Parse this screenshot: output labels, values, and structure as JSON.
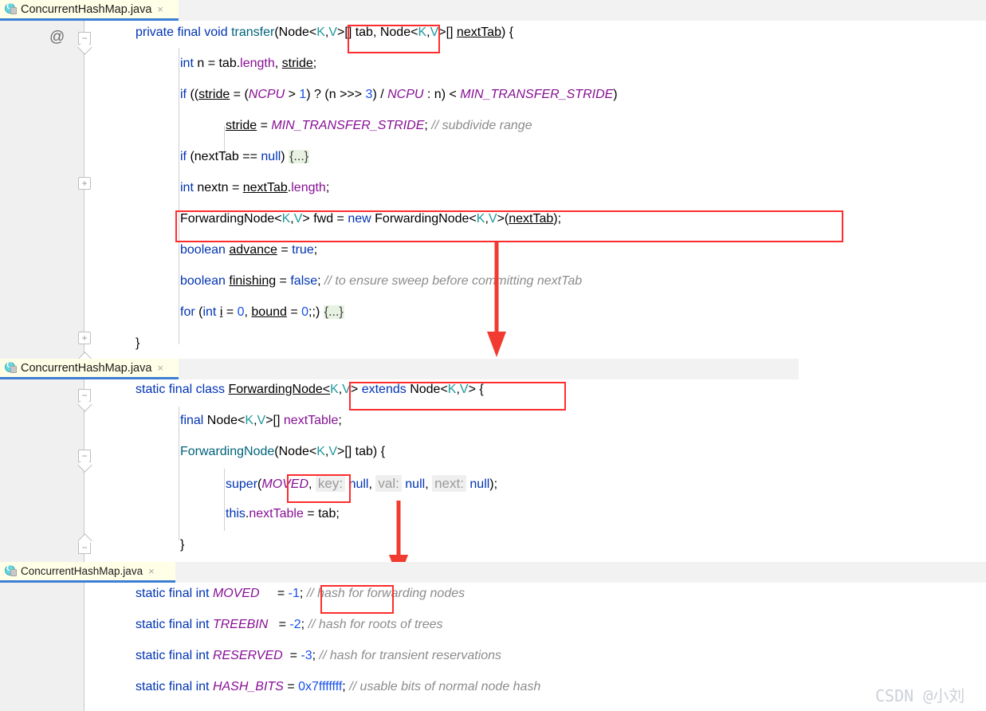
{
  "window": {
    "app": "IntelliJ IDEA editor",
    "accent_color": "#3c7fd4",
    "tab_bg": "#fffee6",
    "gutter_bg": "#f0f0f0",
    "highlight_color": "#ff2d2d",
    "fold_bg": "#e8f2e3"
  },
  "panels": [
    {
      "tab": {
        "label": "ConcurrentHashMap.java",
        "close": "×",
        "icon": "java-class-icon",
        "letter": "C"
      },
      "gutter": {
        "annotation": "@"
      },
      "lines": [
        "private final void transfer(Node<K,V>[] tab, Node<K,V>[] nextTab) {",
        "    int n = tab.length, stride;",
        "    if ((stride = (NCPU > 1) ? (n >>> 3) / NCPU : n) < MIN_TRANSFER_STRIDE)",
        "        stride = MIN_TRANSFER_STRIDE; // subdivide range",
        "    if (nextTab == null) {...}",
        "    int nextn = nextTab.length;",
        "    ForwardingNode<K,V> fwd = new ForwardingNode<K,V>(nextTab);",
        "    boolean advance = true;",
        "    boolean finishing = false; // to ensure sweep before committing nextTab",
        "    for (int i = 0, bound = 0;;) {...}",
        "}"
      ],
      "highlights": [
        "transfer",
        "ForwardingNode<K,V> fwd = new ForwardingNode<K,V>(nextTab);"
      ]
    },
    {
      "tab": {
        "label": "ConcurrentHashMap.java",
        "close": "×",
        "icon": "java-class-icon",
        "letter": "C"
      },
      "lines": [
        "static final class ForwardingNode<K,V> extends Node<K,V> {",
        "    final Node<K,V>[] nextTable;",
        "    ForwardingNode(Node<K,V>[] tab) {",
        "        super(MOVED, key: null, val: null, next: null);",
        "        this.nextTable = tab;",
        "    }"
      ],
      "param_hints": [
        "key:",
        "val:",
        "next:"
      ],
      "highlights": [
        "ForwardingNode<K,V>",
        "MOVED"
      ]
    },
    {
      "tab": {
        "label": "ConcurrentHashMap.java",
        "close": "×",
        "icon": "java-class-icon",
        "letter": "C"
      },
      "lines": [
        "static final int MOVED     = -1; // hash for forwarding nodes",
        "static final int TREEBIN   = -2; // hash for roots of trees",
        "static final int RESERVED  = -3; // hash for transient reservations",
        "static final int HASH_BITS = 0x7fffffff; // usable bits of normal node hash"
      ],
      "constants": [
        {
          "name": "MOVED",
          "value": "-1",
          "comment": "// hash for forwarding nodes"
        },
        {
          "name": "TREEBIN",
          "value": "-2",
          "comment": "// hash for roots of trees"
        },
        {
          "name": "RESERVED",
          "value": "-3",
          "comment": "// hash for transient reservations"
        },
        {
          "name": "HASH_BITS",
          "value": "0x7fffffff",
          "comment": "// usable bits of normal node hash"
        }
      ],
      "highlights": [
        "MOVED"
      ]
    }
  ],
  "tokens": {
    "p1": {
      "l1": {
        "a": "private final void ",
        "b": "transfer",
        "c": "(Node<",
        "k": "K",
        "comma": ",",
        "v": "V",
        "d": ">[] tab, Node<",
        "e": ">[] ",
        "f": "nextTab",
        "g": ") {"
      },
      "l2": {
        "kw": "int",
        "a": " n = tab.",
        "len": "length",
        "b": ", ",
        "stride": "stride",
        "c": ";"
      },
      "l3": {
        "kw": "if",
        "a": " ((",
        "stride": "stride",
        "b": " = (",
        "ncpu": "NCPU",
        "c": " > ",
        "one": "1",
        "d": ") ? (n >>> ",
        "three": "3",
        "e": ") / ",
        "ncpu2": "NCPU",
        "f": " : n) < ",
        "mts": "MIN_TRANSFER_STRIDE",
        "g": ")"
      },
      "l4": {
        "stride": "stride",
        "a": " = ",
        "mts": "MIN_TRANSFER_STRIDE",
        "b": ";",
        "cmt": "// subdivide range"
      },
      "l5": {
        "kw": "if",
        "a": " (nextTab == ",
        "nul": "null",
        "b": ") ",
        "fold": "{...}"
      },
      "l6": {
        "kw": "int",
        "a": " nextn = ",
        "nt": "nextTab",
        "dot": ".",
        "len": "length",
        "b": ";"
      },
      "l7": {
        "a": "ForwardingNode<",
        "k": "K",
        "comma": ",",
        "v": "V",
        "b": "> fwd = ",
        "nw": "new",
        "c": " ForwardingNode<",
        "d": ">(",
        "nt": "nextTab",
        "e": ");"
      },
      "l8": {
        "kw": "boolean",
        "a": " ",
        "adv": "advance",
        "b": " = ",
        "tru": "true",
        "c": ";"
      },
      "l9": {
        "kw": "boolean",
        "a": " ",
        "fin": "finishing",
        "b": " = ",
        "fls": "false",
        "c": ";",
        "cmt": "// to ensure sweep before committing nextTab"
      },
      "l10": {
        "kw": "for",
        "a": " (",
        "kw2": "int",
        "b": " ",
        "i": "i",
        "c": " = ",
        "z1": "0",
        "d": ", ",
        "bound": "bound",
        "e": " = ",
        "z2": "0",
        "f": ";;)",
        "fold": "{...}"
      },
      "l11": {
        "a": "}"
      }
    },
    "p2": {
      "l1": {
        "kw": "static final class",
        "a": " ",
        "cls": "ForwardingNode<",
        "k": "K",
        "comma": ",",
        "v": "V",
        "b": ">",
        "ext": " extends",
        "c": " Node<",
        "d": "> {"
      },
      "l2": {
        "kw": "final",
        "a": " Node<",
        "k": "K",
        "comma": ",",
        "v": "V",
        "b": ">[] ",
        "fld": "nextTable",
        "c": ";"
      },
      "l3": {
        "ctor": "ForwardingNode",
        "a": "(Node<",
        "k": "K",
        "comma": ",",
        "v": "V",
        "b": ">[] tab) {"
      },
      "l4": {
        "sup": "super",
        "a": "(",
        "mv": "MOVED",
        "b": ", ",
        "h1": "key:",
        "n1": "null",
        "c": ", ",
        "h2": "val:",
        "n2": "null",
        "d": ", ",
        "h3": "next:",
        "n3": "null",
        "e": ");"
      },
      "l5": {
        "ths": "this",
        "dot": ".",
        "fld": "nextTable",
        "a": " = tab;"
      },
      "l6": {
        "a": "}"
      }
    },
    "p3": {
      "rows": [
        {
          "kw": "static final int",
          "name": "MOVED",
          "pad": "     ",
          "eq": "= ",
          "val": "-1",
          "semi": ";",
          "cmt": "// hash for forwarding nodes"
        },
        {
          "kw": "static final int",
          "name": "TREEBIN",
          "pad": "   ",
          "eq": "= ",
          "val": "-2",
          "semi": ";",
          "cmt": "// hash for roots of trees"
        },
        {
          "kw": "static final int",
          "name": "RESERVED",
          "pad": "  ",
          "eq": "= ",
          "val": "-3",
          "semi": ";",
          "cmt": "// hash for transient reservations"
        },
        {
          "kw": "static final int",
          "name": "HASH_BITS",
          "pad": " ",
          "eq": "= ",
          "val": "0x7fffffff",
          "semi": ";",
          "cmt": "// usable bits of normal node hash"
        }
      ]
    }
  },
  "watermark": {
    "text": "CSDN @小刘"
  }
}
